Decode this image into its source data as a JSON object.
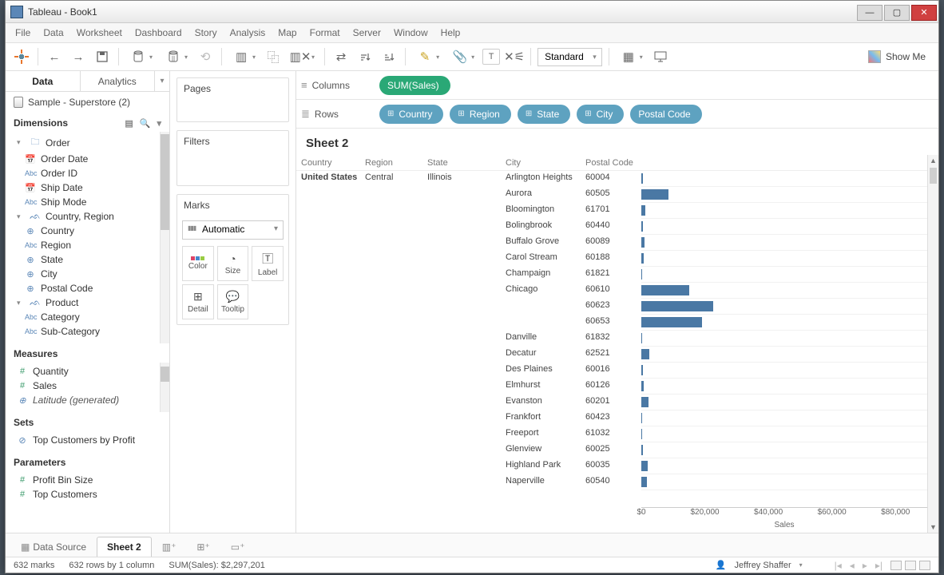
{
  "window": {
    "title": "Tableau - Book1"
  },
  "menu": [
    "File",
    "Data",
    "Worksheet",
    "Dashboard",
    "Story",
    "Analysis",
    "Map",
    "Format",
    "Server",
    "Window",
    "Help"
  ],
  "toolbar": {
    "fit": "Standard",
    "showme": "Show Me"
  },
  "sidebar": {
    "tabs": [
      "Data",
      "Analytics"
    ],
    "datasource": "Sample - Superstore (2)",
    "dim_header": "Dimensions",
    "meas_header": "Measures",
    "sets_header": "Sets",
    "params_header": "Parameters",
    "dimensions": {
      "order": {
        "label": "Order",
        "children": [
          "Order Date",
          "Order ID",
          "Ship Date",
          "Ship Mode"
        ]
      },
      "country_region": {
        "label": "Country, Region",
        "children": [
          "Country",
          "Region",
          "State",
          "City",
          "Postal Code"
        ]
      },
      "product": {
        "label": "Product",
        "children": [
          "Category",
          "Sub-Category"
        ]
      }
    },
    "measures": [
      "Quantity",
      "Sales",
      "Latitude (generated)"
    ],
    "sets": [
      "Top Customers by Profit"
    ],
    "parameters": [
      "Profit Bin Size",
      "Top Customers"
    ]
  },
  "cards": {
    "pages": "Pages",
    "filters": "Filters",
    "marks": "Marks",
    "marks_type": "Automatic",
    "mark_buttons": [
      "Color",
      "Size",
      "Label",
      "Detail",
      "Tooltip"
    ]
  },
  "shelves": {
    "columns_label": "Columns",
    "rows_label": "Rows",
    "columns": [
      "SUM(Sales)"
    ],
    "rows": [
      "Country",
      "Region",
      "State",
      "City",
      "Postal Code"
    ]
  },
  "sheet": {
    "title": "Sheet 2",
    "headers": [
      "Country",
      "Region",
      "State",
      "City",
      "Postal Code"
    ],
    "country": "United States",
    "region": "Central",
    "state": "Illinois",
    "axis_label": "Sales",
    "axis_ticks": [
      "$0",
      "$20,000",
      "$40,000",
      "$60,000",
      "$80,000"
    ]
  },
  "chart_data": {
    "type": "bar",
    "xlabel": "Sales",
    "xlim": [
      0,
      90000
    ],
    "rows": [
      {
        "city": "Arlington Heights",
        "postal": "60004",
        "value": 500
      },
      {
        "city": "Aurora",
        "postal": "60505",
        "value": 8500
      },
      {
        "city": "Bloomington",
        "postal": "61701",
        "value": 1200
      },
      {
        "city": "Bolingbrook",
        "postal": "60440",
        "value": 400
      },
      {
        "city": "Buffalo Grove",
        "postal": "60089",
        "value": 900
      },
      {
        "city": "Carol Stream",
        "postal": "60188",
        "value": 700
      },
      {
        "city": "Champaign",
        "postal": "61821",
        "value": 300
      },
      {
        "city": "Chicago",
        "postal": "60610",
        "value": 15000
      },
      {
        "city": "",
        "postal": "60623",
        "value": 22500
      },
      {
        "city": "",
        "postal": "60653",
        "value": 19000
      },
      {
        "city": "Danville",
        "postal": "61832",
        "value": 200
      },
      {
        "city": "Decatur",
        "postal": "62521",
        "value": 2500
      },
      {
        "city": "Des Plaines",
        "postal": "60016",
        "value": 600
      },
      {
        "city": "Elmhurst",
        "postal": "60126",
        "value": 800
      },
      {
        "city": "Evanston",
        "postal": "60201",
        "value": 2200
      },
      {
        "city": "Frankfort",
        "postal": "60423",
        "value": 300
      },
      {
        "city": "Freeport",
        "postal": "61032",
        "value": 250
      },
      {
        "city": "Glenview",
        "postal": "60025",
        "value": 400
      },
      {
        "city": "Highland Park",
        "postal": "60035",
        "value": 2000
      },
      {
        "city": "Naperville",
        "postal": "60540",
        "value": 1800
      }
    ]
  },
  "tabs": {
    "datasource": "Data Source",
    "active": "Sheet 2"
  },
  "status": {
    "marks": "632 marks",
    "rows": "632 rows by 1 column",
    "sum": "SUM(Sales): $2,297,201",
    "user": "Jeffrey Shaffer"
  }
}
